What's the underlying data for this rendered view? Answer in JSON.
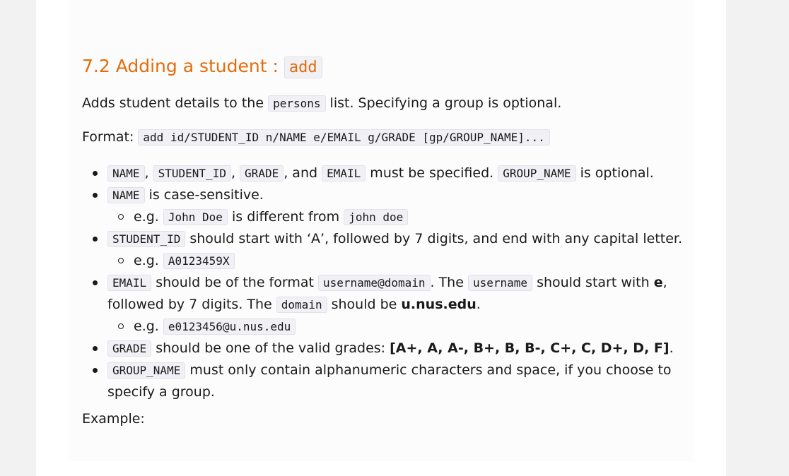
{
  "section": {
    "title_text": "7.2 Adding a student : ",
    "title_code": "add"
  },
  "intro": {
    "pre": "Adds student details to the ",
    "code": "persons",
    "post": " list. Specifying a group is optional."
  },
  "format": {
    "label": "Format: ",
    "code": "add id/STUDENT_ID n/NAME e/EMAIL g/GRADE [gp/GROUP_NAME]..."
  },
  "bullets": {
    "b1": {
      "c1": "NAME",
      "s1": ", ",
      "c2": "STUDENT_ID",
      "s2": ", ",
      "c3": "GRADE",
      "s3": ", and ",
      "c4": "EMAIL",
      "s4": " must be specified. ",
      "c5": "GROUP_NAME",
      "s5": " is optional."
    },
    "b2": {
      "c1": "NAME",
      "s1": " is case-sensitive.",
      "sub": {
        "pre": "e.g. ",
        "c1": "John Doe",
        "mid": " is different from ",
        "c2": "john doe"
      }
    },
    "b3": {
      "c1": "STUDENT_ID",
      "s1": " should start with ‘A’, followed by 7 digits, and end with any capital letter.",
      "sub": {
        "pre": "e.g. ",
        "c1": "A0123459X"
      }
    },
    "b4": {
      "c1": "EMAIL",
      "s1": " should be of the format ",
      "c2": "username@domain",
      "s2": ". The ",
      "c3": "username",
      "s3": " should start with ",
      "b1": "e",
      "s4": ", followed by 7 digits. The ",
      "c4": "domain",
      "s5": " should be ",
      "b2": "u.nus.edu",
      "s6": ".",
      "sub": {
        "pre": "e.g. ",
        "c1": "e0123456@u.nus.edu"
      }
    },
    "b5": {
      "c1": "GRADE",
      "s1": " should be one of the valid grades: ",
      "b1": "[A+, A, A-, B+, B, B-, C+, C, D+, D, F]",
      "s2": "."
    },
    "b6": {
      "c1": "GROUP_NAME",
      "s1": " must only contain alphanumeric characters and space, if you choose to specify a group."
    }
  },
  "example": {
    "label": "Example:"
  }
}
